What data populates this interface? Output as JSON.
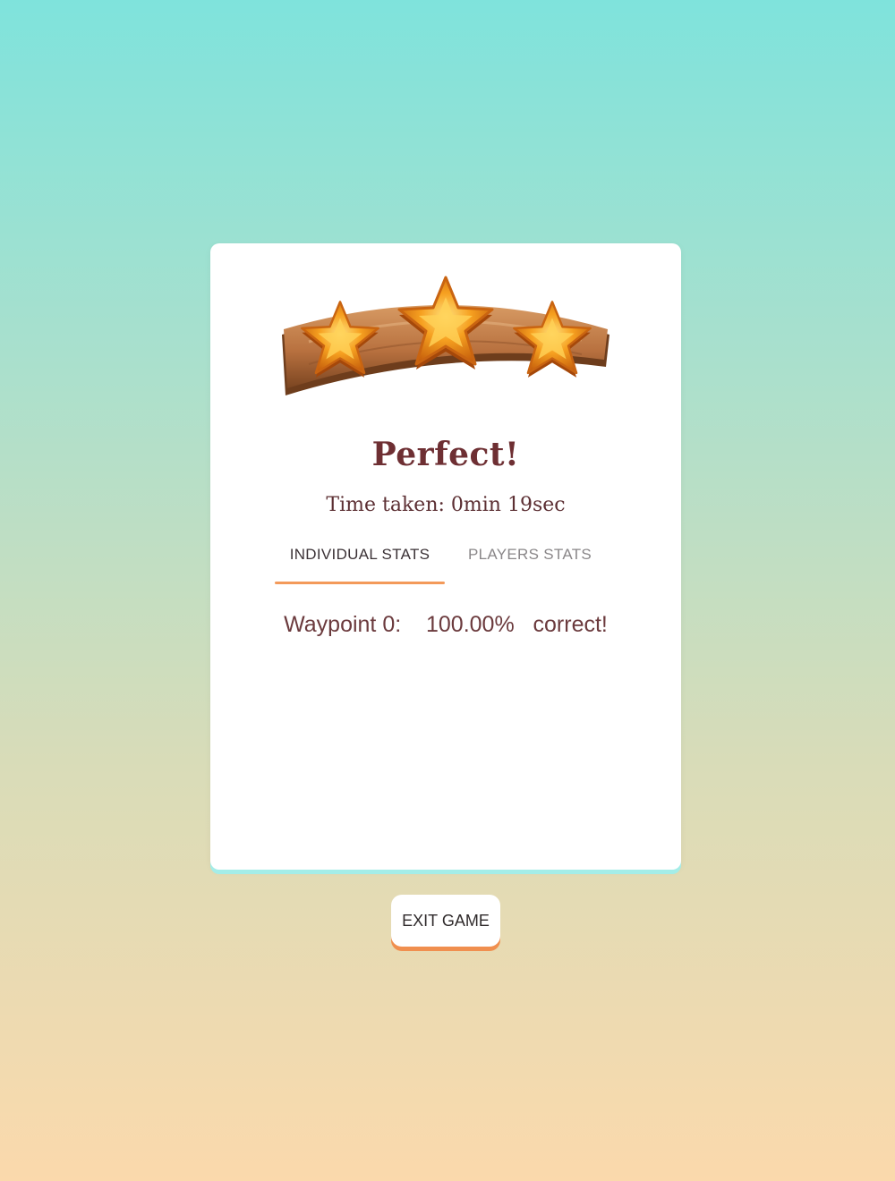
{
  "result": {
    "stars_earned": 3,
    "stars_total": 3,
    "title": "Perfect!",
    "time_taken": "Time taken: 0min 19sec"
  },
  "tabs": [
    {
      "label": "INDIVIDUAL STATS",
      "active": true
    },
    {
      "label": "PLAYERS STATS",
      "active": false
    }
  ],
  "stats": {
    "rows": [
      {
        "label": "Waypoint 0:",
        "value": "100.00%",
        "suffix": "correct!"
      }
    ]
  },
  "actions": {
    "exit_label": "EXIT GAME"
  },
  "colors": {
    "title": "#6e2f33",
    "tab_underline": "#f39a5a",
    "button_shadow": "#f08f4f",
    "star_fill": "#f6a020",
    "plank": "#b8713f"
  },
  "icons": {
    "reward": "wooden-plank-with-three-gold-stars"
  }
}
